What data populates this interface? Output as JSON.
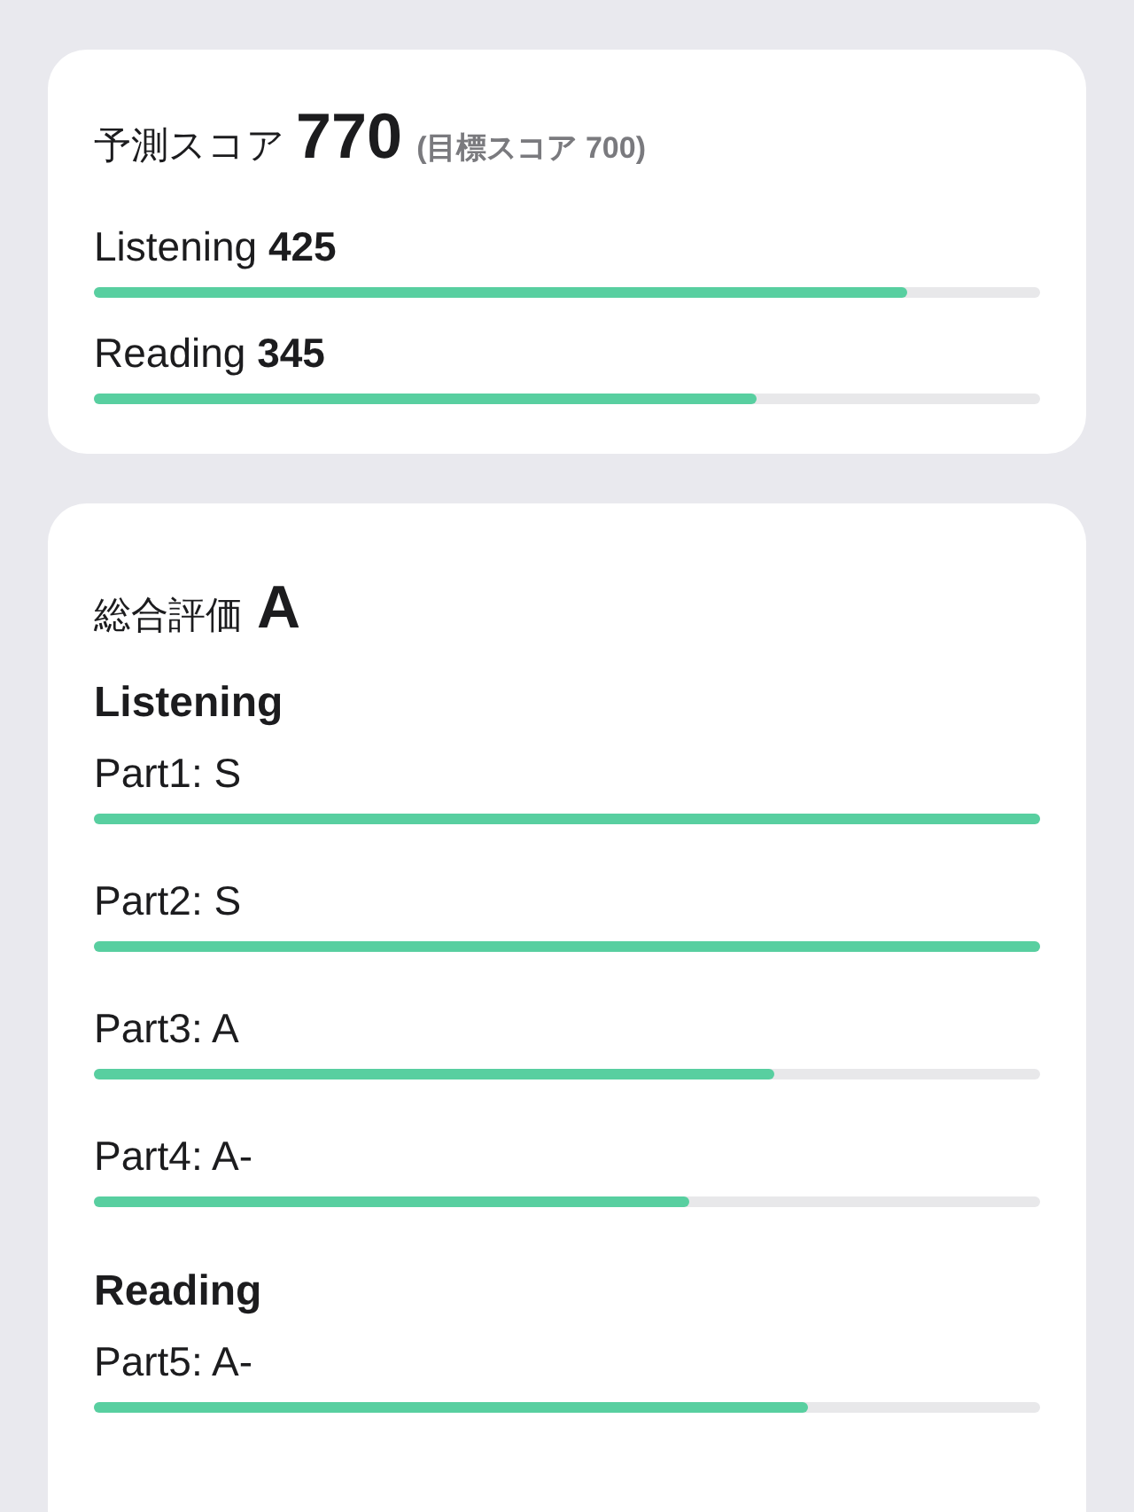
{
  "prediction": {
    "label": "予測スコア",
    "score": "770",
    "target": "(目標スコア 700)",
    "sections": [
      {
        "text": "Listening **425**",
        "level": 0.86
      },
      {
        "text": "Reading **345**",
        "level": 0.7
      }
    ]
  },
  "evaluation": {
    "label": "総合評価",
    "grade": "A",
    "groups": [
      {
        "title": "Listening",
        "parts": [
          {
            "label": "Part1: S",
            "level": 1
          },
          {
            "label": "Part2: S",
            "level": 1
          },
          {
            "label": "Part3: A",
            "level": 0.72
          },
          {
            "label": "Part4: A-",
            "level": 0.63
          }
        ]
      },
      {
        "title": "Reading",
        "parts": [
          {
            "label": "Part5: A-",
            "level": 0.755
          }
        ]
      }
    ]
  }
}
